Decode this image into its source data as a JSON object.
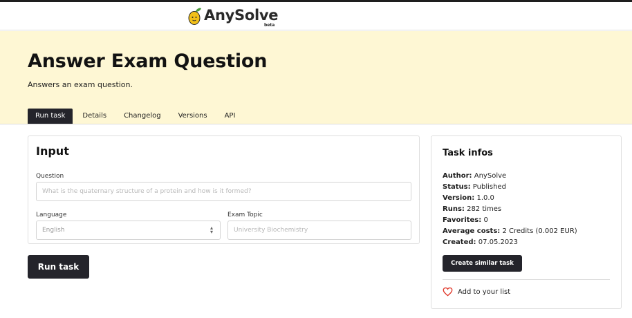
{
  "brand": {
    "name": "AnySolve",
    "badge": "beta"
  },
  "page": {
    "title": "Answer Exam Question",
    "subtitle": "Answers an exam question.",
    "tabs": [
      {
        "label": "Run task",
        "active": true
      },
      {
        "label": "Details",
        "active": false
      },
      {
        "label": "Changelog",
        "active": false
      },
      {
        "label": "Versions",
        "active": false
      },
      {
        "label": "API",
        "active": false
      }
    ]
  },
  "input": {
    "heading": "Input",
    "question": {
      "label": "Question",
      "placeholder": "What is the quaternary structure of a protein and how is it formed?"
    },
    "language": {
      "label": "Language",
      "value": "English"
    },
    "exam_topic": {
      "label": "Exam Topic",
      "placeholder": "University Biochemistry"
    },
    "run_label": "Run task"
  },
  "task_infos": {
    "heading": "Task infos",
    "rows": [
      {
        "key": "Author:",
        "value": "AnySolve"
      },
      {
        "key": "Status:",
        "value": "Published"
      },
      {
        "key": "Version:",
        "value": "1.0.0"
      },
      {
        "key": "Runs:",
        "value": "282 times"
      },
      {
        "key": "Favorites:",
        "value": "0"
      },
      {
        "key": "Average costs:",
        "value": "2 Credits (0.002 EUR)"
      },
      {
        "key": "Created:",
        "value": "07.05.2023"
      }
    ],
    "create_similar_label": "Create similar task",
    "add_to_list_label": "Add to your list"
  },
  "colors": {
    "hero_background": "#fef7d4",
    "dark_button": "#24242b",
    "heart": "#e0392b",
    "logo_lemon": "#f2c018",
    "logo_leaf": "#4a9b3c"
  },
  "icons": {
    "logo": "lemon-logo-icon",
    "select": "chevron-up-down-icon",
    "favorite": "heart-outline-icon"
  }
}
